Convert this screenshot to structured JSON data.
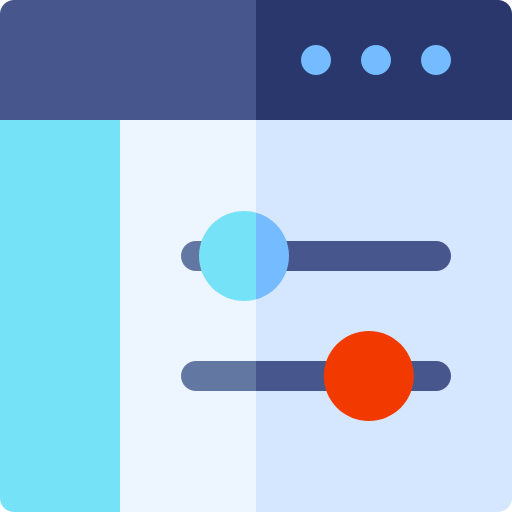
{
  "window": {
    "controls": [
      {
        "name": "window-dot-1",
        "color": "#74BBFF"
      },
      {
        "name": "window-dot-2",
        "color": "#74BBFF"
      },
      {
        "name": "window-dot-3",
        "color": "#74BBFF"
      }
    ]
  },
  "colors": {
    "titlebar_left": "#47568C",
    "titlebar_right": "#29376D",
    "sidebar": "#76E2F8",
    "content_left": "#EDF5FF",
    "content_right": "#D5E6FF",
    "track_left": "#6278A3",
    "track_right": "#47568C"
  },
  "sliders": [
    {
      "name": "slider-1",
      "value": 0.2,
      "thumb_colors": [
        "#76E2F8",
        "#74BBFF"
      ]
    },
    {
      "name": "slider-2",
      "value": 0.72,
      "thumb_colors": [
        "#F23A00",
        "#F23A00"
      ]
    }
  ]
}
